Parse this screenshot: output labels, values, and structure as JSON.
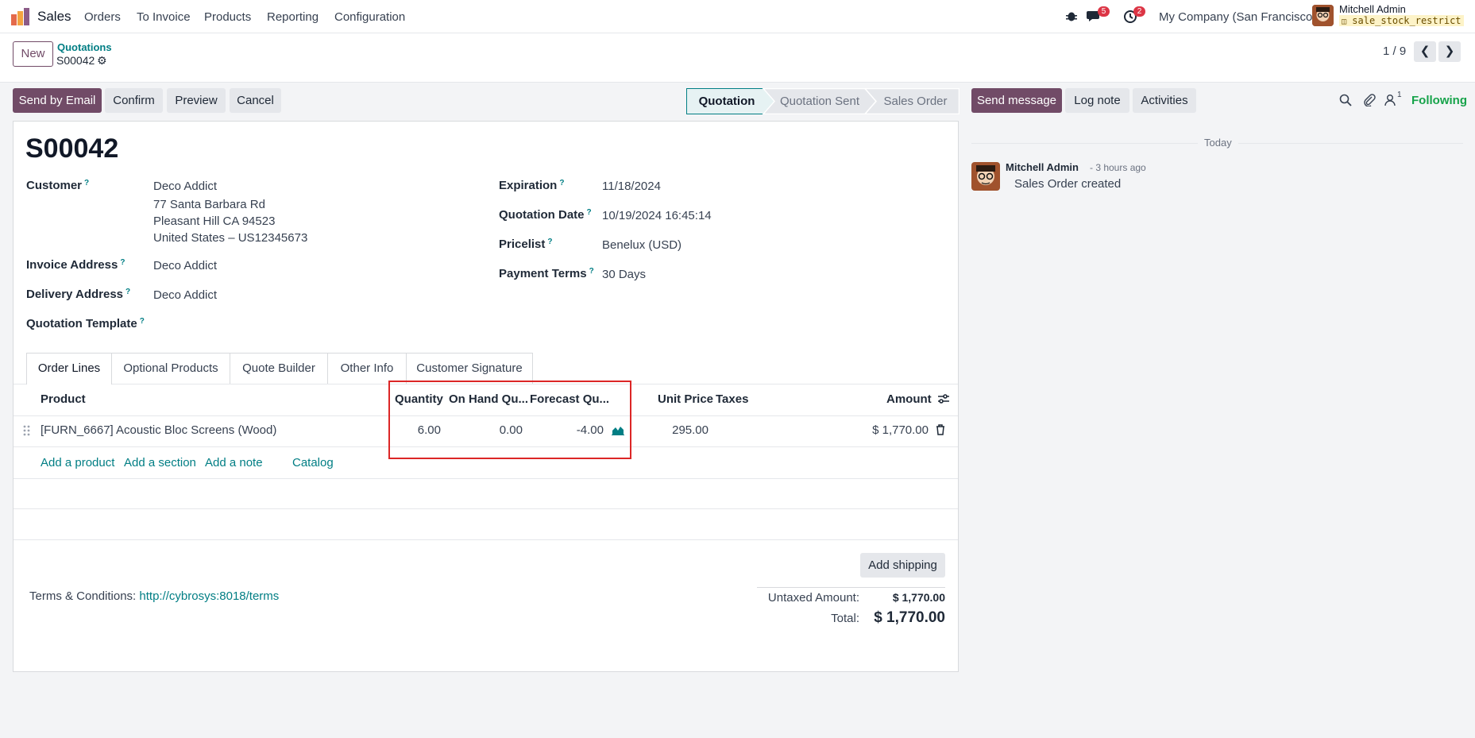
{
  "nav": {
    "app_name": "Sales",
    "menu": [
      "Orders",
      "To Invoice",
      "Products",
      "Reporting",
      "Configuration"
    ],
    "messages_count": "5",
    "activities_count": "2",
    "company": "My Company (San Francisco)",
    "user_name": "Mitchell Admin",
    "db_name": "sale_stock_restrict"
  },
  "control": {
    "new_label": "New",
    "breadcrumb_parent": "Quotations",
    "breadcrumb_current": "S00042",
    "pager": "1 / 9"
  },
  "actions": {
    "send_email": "Send by Email",
    "confirm": "Confirm",
    "preview": "Preview",
    "cancel": "Cancel"
  },
  "stages": [
    "Quotation",
    "Quotation Sent",
    "Sales Order"
  ],
  "form": {
    "name": "S00042",
    "customer_label": "Customer",
    "customer_name": "Deco Addict",
    "customer_addr1": "77 Santa Barbara Rd",
    "customer_addr2": "Pleasant Hill CA 94523",
    "customer_addr3": "United States – US12345673",
    "invoice_label": "Invoice Address",
    "invoice_value": "Deco Addict",
    "delivery_label": "Delivery Address",
    "delivery_value": "Deco Addict",
    "template_label": "Quotation Template",
    "expiration_label": "Expiration",
    "expiration_value": "11/18/2024",
    "qdate_label": "Quotation Date",
    "qdate_value": "10/19/2024 16:45:14",
    "pricelist_label": "Pricelist",
    "pricelist_value": "Benelux (USD)",
    "terms_label": "Payment Terms",
    "terms_value": "30 Days",
    "question": "?"
  },
  "tabs": [
    "Order Lines",
    "Optional Products",
    "Quote Builder",
    "Other Info",
    "Customer Signature"
  ],
  "table": {
    "headers": {
      "product": "Product",
      "quantity": "Quantity",
      "onhand": "On Hand Qu...",
      "forecast": "Forecast Qu...",
      "unit_price": "Unit Price",
      "taxes": "Taxes",
      "amount": "Amount"
    },
    "row": {
      "product": "[FURN_6667] Acoustic Bloc Screens (Wood)",
      "quantity": "6.00",
      "onhand": "0.00",
      "forecast": "-4.00",
      "unit_price": "295.00",
      "amount": "$ 1,770.00"
    },
    "add_product": "Add a product",
    "add_section": "Add a section",
    "add_note": "Add a note",
    "catalog": "Catalog"
  },
  "footer": {
    "add_shipping": "Add shipping",
    "terms_prefix": "Terms & Conditions:",
    "terms_link": "http://cybrosys:8018/terms",
    "untaxed_label": "Untaxed Amount:",
    "untaxed_value": "$ 1,770.00",
    "total_label": "Total:",
    "total_value": "$ 1,770.00"
  },
  "chatter": {
    "send_message": "Send message",
    "log_note": "Log note",
    "activities": "Activities",
    "followers_count": "1",
    "following": "Following",
    "date_sep": "Today",
    "author": "Mitchell Admin",
    "time": "- 3 hours ago",
    "body": "Sales Order created"
  },
  "colors": {
    "primary": "#714b67",
    "link": "#017e84",
    "highlight": "#dc2626",
    "following": "#16a34a"
  }
}
